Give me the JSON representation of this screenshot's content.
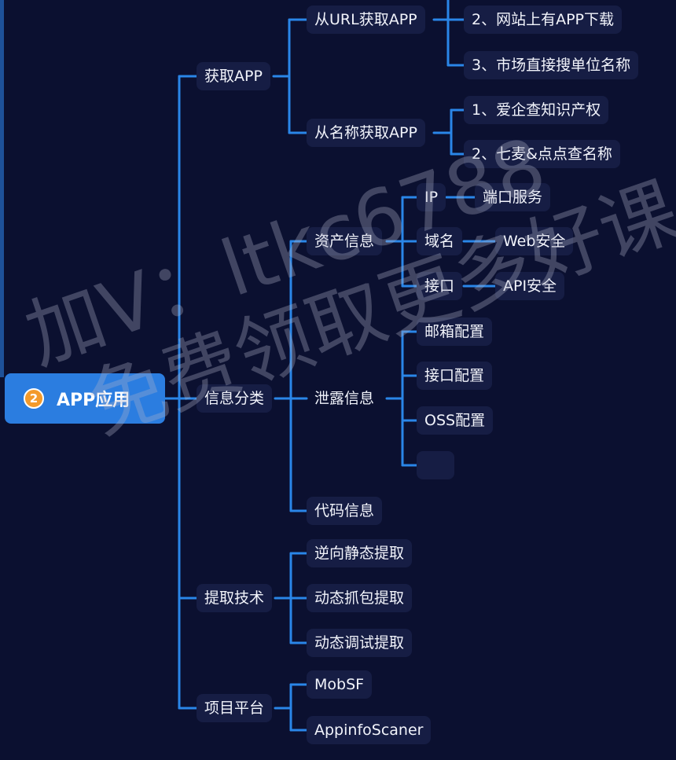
{
  "colors": {
    "background": "#0b1030",
    "node": "#161d44",
    "line": "#2a86e8",
    "root": "#2b7de0",
    "badge": "#f39a2b"
  },
  "root": {
    "badge": "2",
    "label": "APP应用"
  },
  "branches": {
    "get_app": {
      "label": "获取APP",
      "from_url": {
        "label": "从URL获取APP",
        "items": [
          "2、网站上有APP下载",
          "3、市场直接搜单位名称"
        ]
      },
      "from_name": {
        "label": "从名称获取APP",
        "items": [
          "1、爱企查知识产权",
          "2、七麦&点点查名称"
        ]
      }
    },
    "info": {
      "label": "信息分类",
      "assets": {
        "label": "资产信息",
        "ip": {
          "label": "IP",
          "child": "端口服务"
        },
        "domain": {
          "label": "域名",
          "child": "Web安全"
        },
        "api": {
          "label": "接口",
          "child": "API安全"
        }
      },
      "leak": {
        "label": "泄露信息",
        "items": [
          "邮箱配置",
          "接口配置",
          "OSS配置"
        ]
      },
      "code": {
        "label": "代码信息"
      }
    },
    "extract": {
      "label": "提取技术",
      "items": [
        "逆向静态提取",
        "动态抓包提取",
        "动态调试提取"
      ]
    },
    "platform": {
      "label": "项目平台",
      "items": [
        "MobSF",
        "AppinfoScaner"
      ]
    }
  },
  "watermark": {
    "line1": "加V：ltkc6788",
    "line2": "免费领取更多好课"
  }
}
